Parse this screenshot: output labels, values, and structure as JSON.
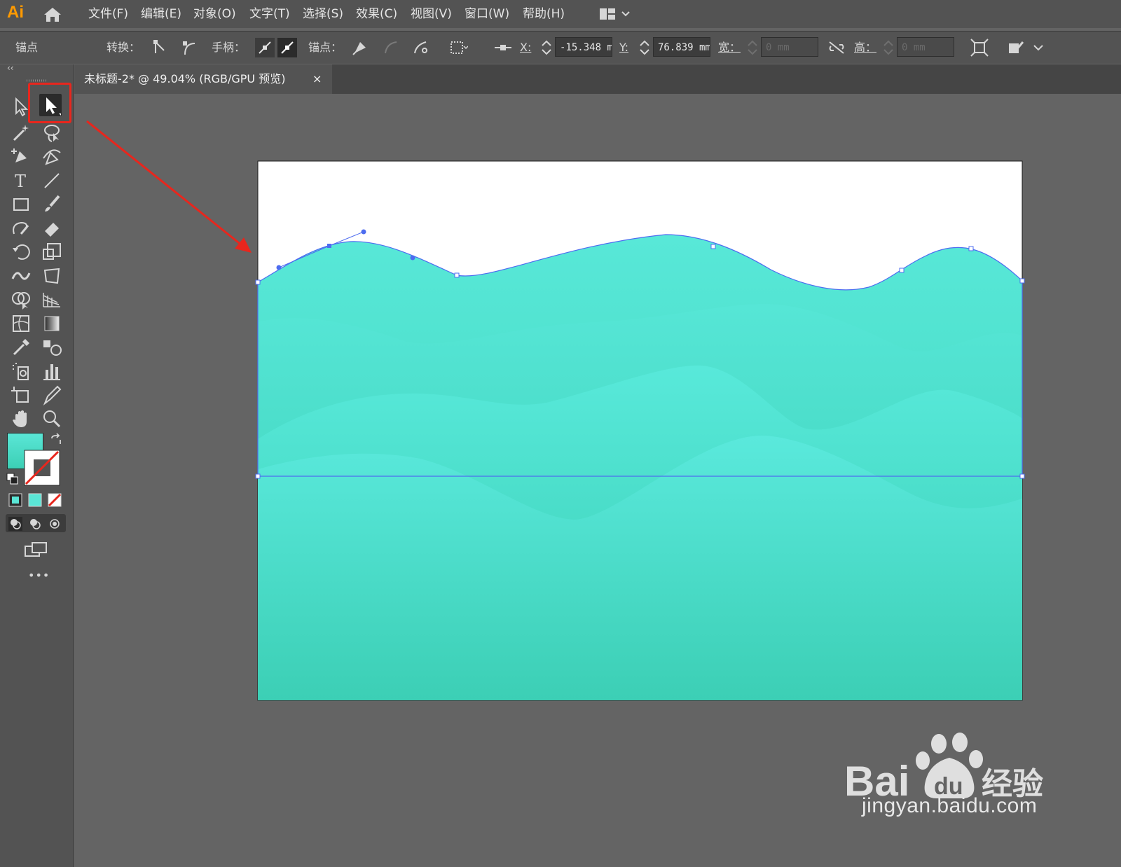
{
  "app": {
    "logo": "Ai"
  },
  "menus": [
    "文件(F)",
    "编辑(E)",
    "对象(O)",
    "文字(T)",
    "选择(S)",
    "效果(C)",
    "视图(V)",
    "窗口(W)",
    "帮助(H)"
  ],
  "control_bar": {
    "anchor_label": "锚点",
    "convert_label": "转换：",
    "handles_label": "手柄：",
    "anchors_label": "锚点：",
    "x_label": "X:",
    "x_value": "-15.348 m",
    "y_label": "Y:",
    "y_value": "76.839 mm",
    "w_label": "宽：",
    "w_value": "0 mm",
    "h_label": "高：",
    "h_value": "0 mm"
  },
  "document_tab": {
    "title": "未标题-2* @ 49.04% (RGB/GPU 预览)",
    "close": "×"
  },
  "toolbar": {
    "collapse": "‹‹",
    "tools": [
      [
        "selection-tool",
        "direct-selection-tool"
      ],
      [
        "magic-wand-tool",
        "lasso-tool"
      ],
      [
        "pen-tool",
        "curvature-tool"
      ],
      [
        "type-tool",
        "line-segment-tool"
      ],
      [
        "rectangle-tool",
        "paintbrush-tool"
      ],
      [
        "shaper-tool",
        "eraser-tool"
      ],
      [
        "rotate-tool",
        "scale-tool"
      ],
      [
        "width-tool",
        "free-transform-tool"
      ],
      [
        "shape-builder-tool",
        "perspective-grid-tool"
      ],
      [
        "mesh-tool",
        "gradient-tool"
      ],
      [
        "eyedropper-tool",
        "blend-tool"
      ],
      [
        "symbol-sprayer-tool",
        "column-graph-tool"
      ],
      [
        "artboard-tool",
        "slice-tool"
      ],
      [
        "hand-tool",
        "zoom-tool"
      ]
    ],
    "more": "•••"
  },
  "colors": {
    "fill_gradient_top": "#5ae6d6",
    "fill_gradient_bottom": "#18ae7c",
    "highlight": "#e8261d",
    "selection_path": "#4d6cf0"
  },
  "watermark": {
    "site": "jingyan.baidu.com",
    "brand_cn": "经验"
  }
}
